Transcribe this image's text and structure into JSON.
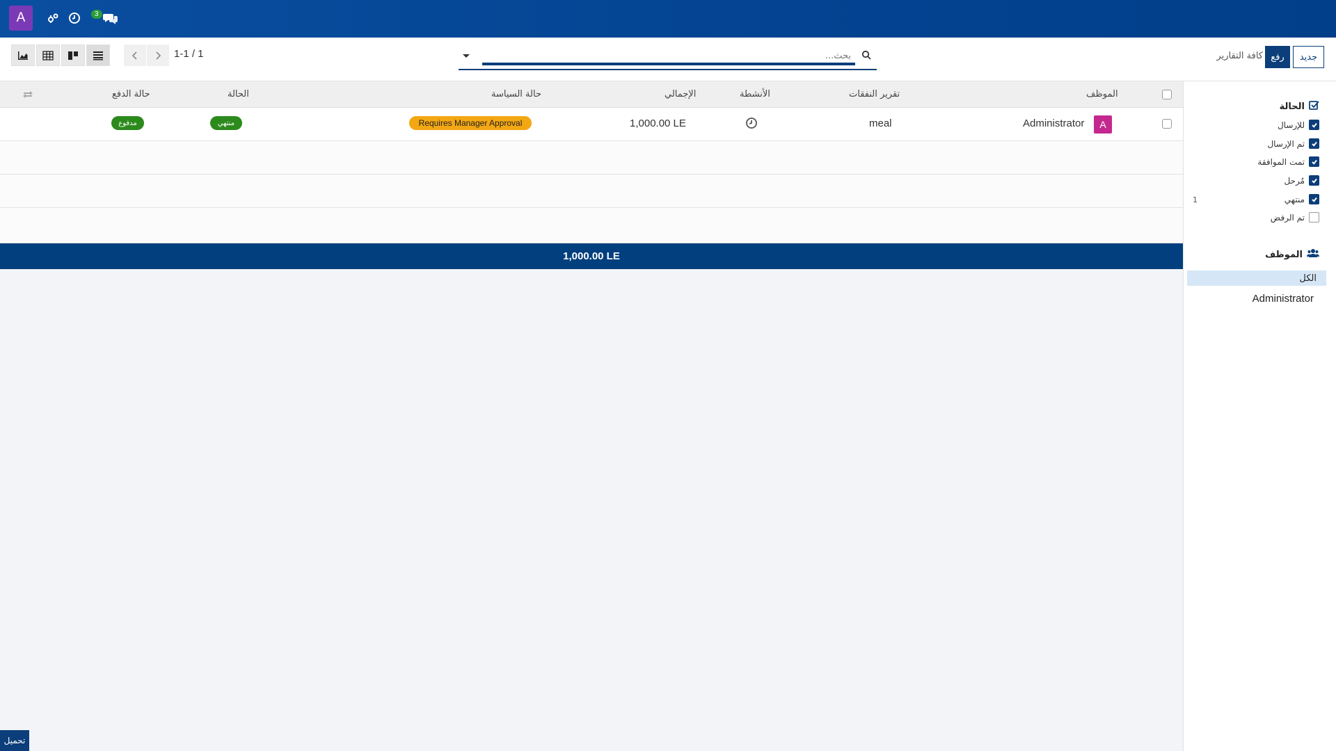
{
  "navbar": {
    "avatar_letter": "A",
    "messages_badge": "3",
    "bg_color": "#034391",
    "icons": [
      "debug-icon",
      "clock-icon",
      "chat-icon"
    ]
  },
  "control": {
    "search_placeholder": "بحث...",
    "pager": "1-1 / 1",
    "new_label": "جديد",
    "upload_label": "رفع",
    "all_reports_label": "كافة التقارير",
    "views": [
      "graph-view",
      "pivot-view",
      "kanban-view",
      "list-view"
    ]
  },
  "table": {
    "headers": {
      "employee": "الموظف",
      "report": "تقرير النفقات",
      "activities": "الأنشطة",
      "total": "الإجمالي",
      "policy": "حالة السياسة",
      "status": "الحالة",
      "payment": "حالة الدفع"
    },
    "rows": [
      {
        "employee_initial": "A",
        "employee": "Administrator",
        "report": "meal",
        "total": "1,000.00 LE",
        "policy": "Requires Manager Approval",
        "status": "منتهي",
        "payment": "مدفوع"
      }
    ],
    "footer_total": "1,000.00 LE"
  },
  "sidepanel": {
    "status_title": "الحالة",
    "status_items": [
      {
        "label": "للإرسال",
        "checked": true
      },
      {
        "label": "تم الإرسال",
        "checked": true
      },
      {
        "label": "تمت الموافقة",
        "checked": true
      },
      {
        "label": "مُرحل",
        "checked": true
      },
      {
        "label": "منتهي",
        "checked": true,
        "count": "1"
      },
      {
        "label": "تم الرفض",
        "checked": false
      }
    ],
    "employee_title": "الموظف",
    "all_label": "الكل",
    "employee_item": "Administrator"
  },
  "load_label": "تحميل",
  "colors": {
    "primary": "#0b3e7a",
    "accent_orange": "#f3a712",
    "success_green": "#2c8a1c",
    "avatar_purple": "#7b3ab5",
    "avatar_magenta": "#c4288f"
  }
}
